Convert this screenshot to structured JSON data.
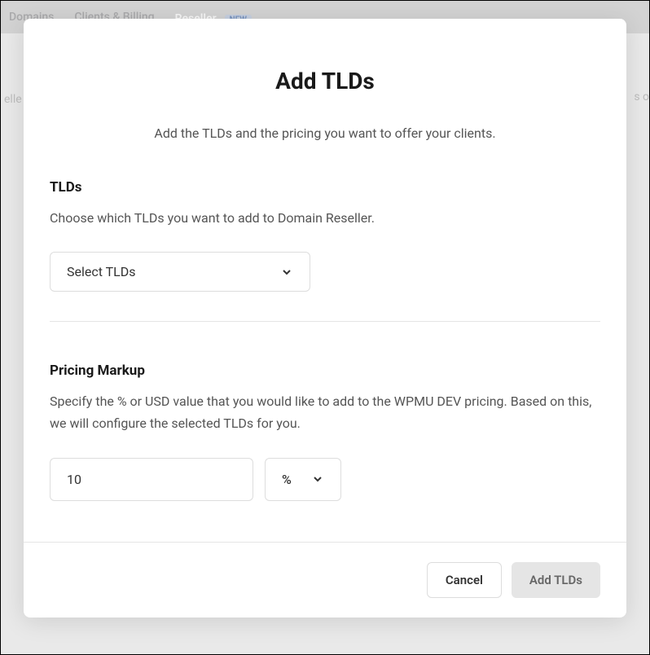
{
  "nav": {
    "domains": "Domains",
    "clients": "Clients & Billing",
    "reseller": "Reseller",
    "badge": "NEW"
  },
  "bg": {
    "left": "elle",
    "right": "s o"
  },
  "modal": {
    "title": "Add TLDs",
    "subtitle": "Add the TLDs and the pricing you want to offer your clients."
  },
  "tlds": {
    "title": "TLDs",
    "desc": "Choose which TLDs you want to add to Domain Reseller.",
    "select_label": "Select TLDs"
  },
  "pricing": {
    "title": "Pricing Markup",
    "desc": "Specify the % or USD value that you would like to add to the WPMU DEV pricing. Based on this, we will configure the selected TLDs for you.",
    "value": "10",
    "unit": "%"
  },
  "footer": {
    "cancel": "Cancel",
    "add": "Add TLDs"
  }
}
